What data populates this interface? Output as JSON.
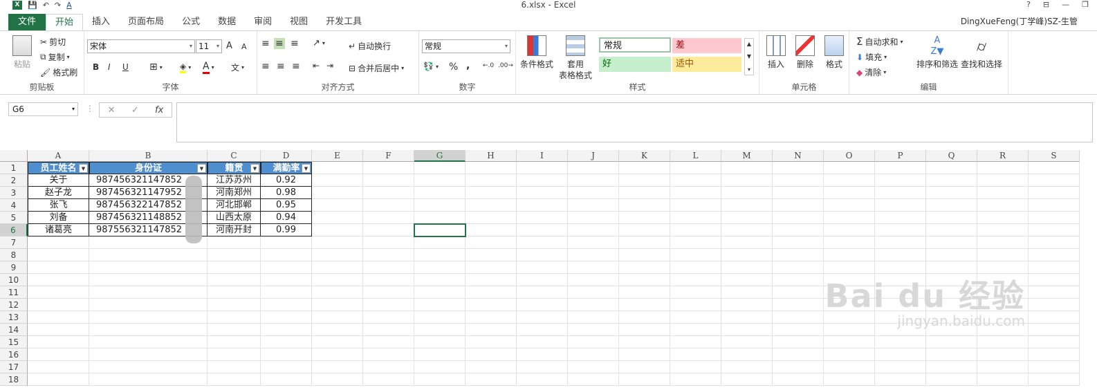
{
  "title": "6.xlsx - Excel",
  "qat": {
    "undo": "↶",
    "redo": "↷",
    "font_color": "A"
  },
  "window_controls": [
    "?",
    "⊟",
    "—",
    "❐"
  ],
  "tabs": [
    "文件",
    "开始",
    "插入",
    "页面布局",
    "公式",
    "数据",
    "审阅",
    "视图",
    "开发工具"
  ],
  "user": "DingXueFeng(丁学峰)SZ-生管",
  "ribbon": {
    "clipboard": {
      "paste": "粘贴",
      "cut": "剪切",
      "copy": "复制",
      "format_painter": "格式刷",
      "label": "剪贴板"
    },
    "font": {
      "name": "宋体",
      "size": "11",
      "bold": "B",
      "italic": "I",
      "underline": "U",
      "grow": "A",
      "shrink": "A",
      "wen": "文",
      "label": "字体"
    },
    "alignment": {
      "wrap": "自动换行",
      "merge": "合并后居中",
      "label": "对齐方式"
    },
    "number": {
      "format": "常规",
      "percent": "%",
      "comma": ",",
      "label": "数字"
    },
    "styles": {
      "conditional": "条件格式",
      "table": "套用",
      "table2": "表格格式",
      "normal": "常规",
      "bad": "差",
      "good": "好",
      "neutral": "适中",
      "label": "样式"
    },
    "cells": {
      "insert": "插入",
      "delete": "删除",
      "format": "格式",
      "label": "单元格"
    },
    "editing": {
      "autosum": "自动求和",
      "fill": "填充",
      "clear": "清除",
      "sort": "排序和筛选",
      "find": "查找和选择",
      "label": "编辑"
    }
  },
  "namebox": "G6",
  "formula_icons": {
    "cancel": "✕",
    "enter": "✓",
    "fx": "fx"
  },
  "columns": [
    "A",
    "B",
    "C",
    "D",
    "E",
    "F",
    "G",
    "H",
    "I",
    "J",
    "K",
    "L",
    "M",
    "N",
    "O",
    "P",
    "Q",
    "R",
    "S"
  ],
  "rows": [
    "1",
    "2",
    "3",
    "4",
    "5",
    "6",
    "7",
    "8",
    "9",
    "10",
    "11",
    "12",
    "13",
    "14",
    "15",
    "16",
    "17",
    "18"
  ],
  "table": {
    "headers": [
      "员工姓名",
      "身份证",
      "籍贯",
      "满勤率"
    ],
    "data": [
      [
        "关于",
        "987456321147852",
        "江苏苏州",
        "0.92"
      ],
      [
        "赵子龙",
        "987456321147952",
        "河南郑州",
        "0.98"
      ],
      [
        "张飞",
        "987456322147852",
        "河北邯郸",
        "0.95"
      ],
      [
        "刘备",
        "987456321148852",
        "山西太原",
        "0.94"
      ],
      [
        "诸葛亮",
        "987556321147852",
        "河南开封",
        "0.99"
      ]
    ]
  },
  "watermark": {
    "brand": "Bai du 经验",
    "url": "jingyan.baidu.com"
  }
}
